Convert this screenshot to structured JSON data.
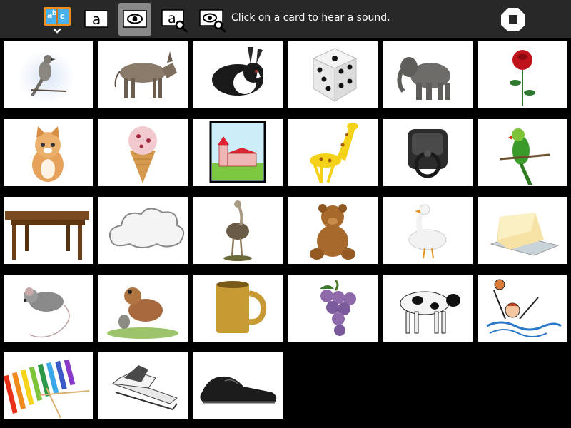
{
  "toolbar": {
    "tools": [
      {
        "name": "activity-book-icon",
        "kind": "abc-book"
      },
      {
        "name": "letter-mode-icon",
        "kind": "letter"
      },
      {
        "name": "picture-mode-icon",
        "kind": "eye"
      },
      {
        "name": "letter-search-icon",
        "kind": "letter-search"
      },
      {
        "name": "picture-search-icon",
        "kind": "eye-search"
      }
    ],
    "book_letters": "abc",
    "letter_glyph": "a",
    "hint": "Click on a card to hear a sound.",
    "colors": {
      "bar": "#282828",
      "active": "#8a8a8a",
      "book": "#f28c1c",
      "book_page": "#4ab0e8"
    }
  },
  "cards": [
    {
      "subject": "mockingbird"
    },
    {
      "subject": "donkey"
    },
    {
      "subject": "rabbit"
    },
    {
      "subject": "dice"
    },
    {
      "subject": "elephant"
    },
    {
      "subject": "rose"
    },
    {
      "subject": "kitten"
    },
    {
      "subject": "ice-cream"
    },
    {
      "subject": "church"
    },
    {
      "subject": "giraffe"
    },
    {
      "subject": "door-knocker"
    },
    {
      "subject": "parrot"
    },
    {
      "subject": "table"
    },
    {
      "subject": "cloud"
    },
    {
      "subject": "ostrich"
    },
    {
      "subject": "teddy-bear"
    },
    {
      "subject": "goose"
    },
    {
      "subject": "cheese"
    },
    {
      "subject": "mouse"
    },
    {
      "subject": "toad"
    },
    {
      "subject": "mug"
    },
    {
      "subject": "grapes"
    },
    {
      "subject": "cow"
    },
    {
      "subject": "water-polo"
    },
    {
      "subject": "xylophone"
    },
    {
      "subject": "motorboat"
    },
    {
      "subject": "shoe"
    }
  ]
}
